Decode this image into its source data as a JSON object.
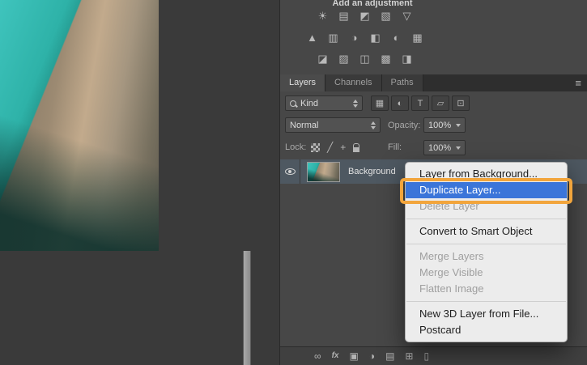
{
  "adjustments": {
    "title": "Add an adjustment",
    "row1": [
      {
        "name": "brightness-contrast",
        "glyph": "☀"
      },
      {
        "name": "levels",
        "glyph": "▤"
      },
      {
        "name": "curves",
        "glyph": "◩"
      },
      {
        "name": "exposure",
        "glyph": "▧"
      },
      {
        "name": "color-lookup",
        "glyph": "▽"
      }
    ],
    "row2": [
      {
        "name": "vibrance",
        "glyph": "▲"
      },
      {
        "name": "hue-saturation",
        "glyph": "▥"
      },
      {
        "name": "color-balance",
        "glyph": "◑"
      },
      {
        "name": "black-white",
        "glyph": "◧"
      },
      {
        "name": "photo-filter",
        "glyph": "◐"
      },
      {
        "name": "channel-mixer",
        "glyph": "▦"
      }
    ],
    "row3": [
      {
        "name": "invert",
        "glyph": "◪"
      },
      {
        "name": "posterize",
        "glyph": "▨"
      },
      {
        "name": "threshold",
        "glyph": "◫"
      },
      {
        "name": "gradient-map",
        "glyph": "▩"
      },
      {
        "name": "selective-color",
        "glyph": "◨"
      }
    ]
  },
  "layers_panel": {
    "tabs": [
      "Layers",
      "Channels",
      "Paths"
    ],
    "active_tab": "Layers",
    "panel_menu_icon": "≡",
    "filter": {
      "kind_label": "Kind",
      "type_icons": [
        {
          "name": "filter-pixel-layers",
          "glyph": "▦"
        },
        {
          "name": "filter-adjustment-layers",
          "glyph": "◐"
        },
        {
          "name": "filter-type-layers",
          "glyph": "T"
        },
        {
          "name": "filter-shape-layers",
          "glyph": "▱"
        },
        {
          "name": "filter-smart-objects",
          "glyph": "⊡"
        }
      ]
    },
    "blend_mode": "Normal",
    "opacity_label": "Opacity:",
    "opacity_value": "100%",
    "lock_label": "Lock:",
    "lock_icons": [
      {
        "name": "lock-transparent-pixels"
      },
      {
        "name": "lock-image-pixels",
        "glyph": "╱"
      },
      {
        "name": "lock-position",
        "glyph": "+"
      },
      {
        "name": "lock-all"
      }
    ],
    "fill_label": "Fill:",
    "fill_value": "100%",
    "layers": [
      {
        "name": "Background",
        "visible": true,
        "selected": true
      }
    ],
    "footer_icons": [
      {
        "name": "link-layers",
        "glyph": "∞"
      },
      {
        "name": "layer-effects",
        "glyph": "fx"
      },
      {
        "name": "add-layer-mask",
        "glyph": "▣"
      },
      {
        "name": "new-adjustment-layer",
        "glyph": "◑"
      },
      {
        "name": "new-group",
        "glyph": "▤"
      },
      {
        "name": "new-layer",
        "glyph": "⊞"
      },
      {
        "name": "delete-layer",
        "glyph": "▯"
      }
    ]
  },
  "context_menu": {
    "items": [
      {
        "label": "Layer from Background...",
        "state": "enabled"
      },
      {
        "label": "Duplicate Layer...",
        "state": "highlighted"
      },
      {
        "label": "Delete Layer",
        "state": "disabled"
      },
      {
        "separator": true
      },
      {
        "label": "Convert to Smart Object",
        "state": "enabled"
      },
      {
        "separator": true
      },
      {
        "label": "Merge Layers",
        "state": "disabled"
      },
      {
        "label": "Merge Visible",
        "state": "disabled"
      },
      {
        "label": "Flatten Image",
        "state": "disabled"
      },
      {
        "separator": true
      },
      {
        "label": "New 3D Layer from File...",
        "state": "enabled"
      },
      {
        "label": "Postcard",
        "state": "enabled"
      }
    ],
    "selection_color": "#3b75d9"
  },
  "annotation": {
    "color": "#f2a53c",
    "target": "Duplicate Layer..."
  }
}
